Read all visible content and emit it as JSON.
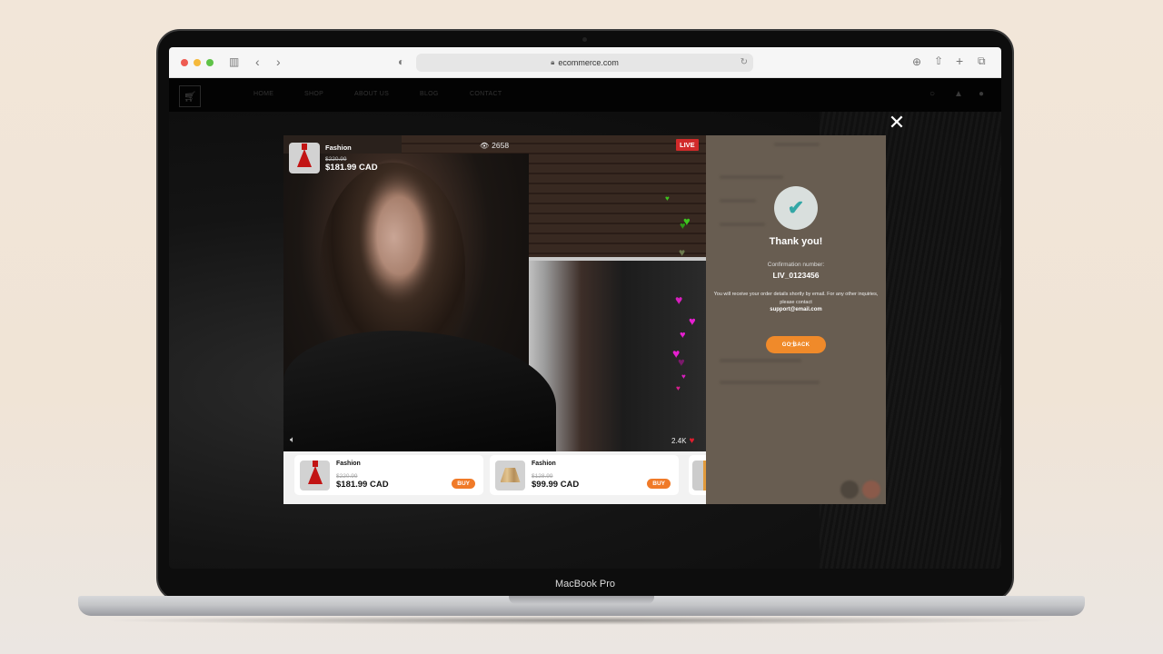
{
  "device": {
    "label": "MacBook Pro"
  },
  "browser": {
    "url": "ecommerce.com",
    "icons": [
      "sidebar-icon",
      "back-icon",
      "forward-icon",
      "shield-icon",
      "reload-icon",
      "download-icon",
      "share-icon",
      "new-tab-icon",
      "tabs-icon"
    ]
  },
  "site_nav": {
    "links": [
      "HOME",
      "SHOP",
      "ABOUT US",
      "BLOG",
      "CONTACT"
    ],
    "icons": [
      "search-icon",
      "bell-icon",
      "user-icon"
    ]
  },
  "live_stream": {
    "badge": "LIVE",
    "viewers": "2658",
    "likes": "2.4K",
    "featured_product": {
      "title": "Fashion",
      "old_price": "$220.99",
      "price": "$181.99 CAD"
    }
  },
  "products": [
    {
      "title": "Fashion",
      "old_price": "$220.99",
      "price": "$181.99 CAD",
      "buy_label": "BUY"
    },
    {
      "title": "Fashion",
      "old_price": "$128.99",
      "price": "$99.99 CAD",
      "buy_label": "BUY"
    }
  ],
  "confirmation": {
    "title": "Thank you!",
    "number_label": "Confirmation number:",
    "number": "LIV_0123456",
    "message": "You will receive your order details shortly by email. For any other inquiries, please contact",
    "email": "support@email.com",
    "button_label": "GO BACK"
  },
  "colors": {
    "accent": "#f08a2a",
    "live": "#d12a2a",
    "check": "#33a7a6",
    "panel": "#685d51"
  }
}
